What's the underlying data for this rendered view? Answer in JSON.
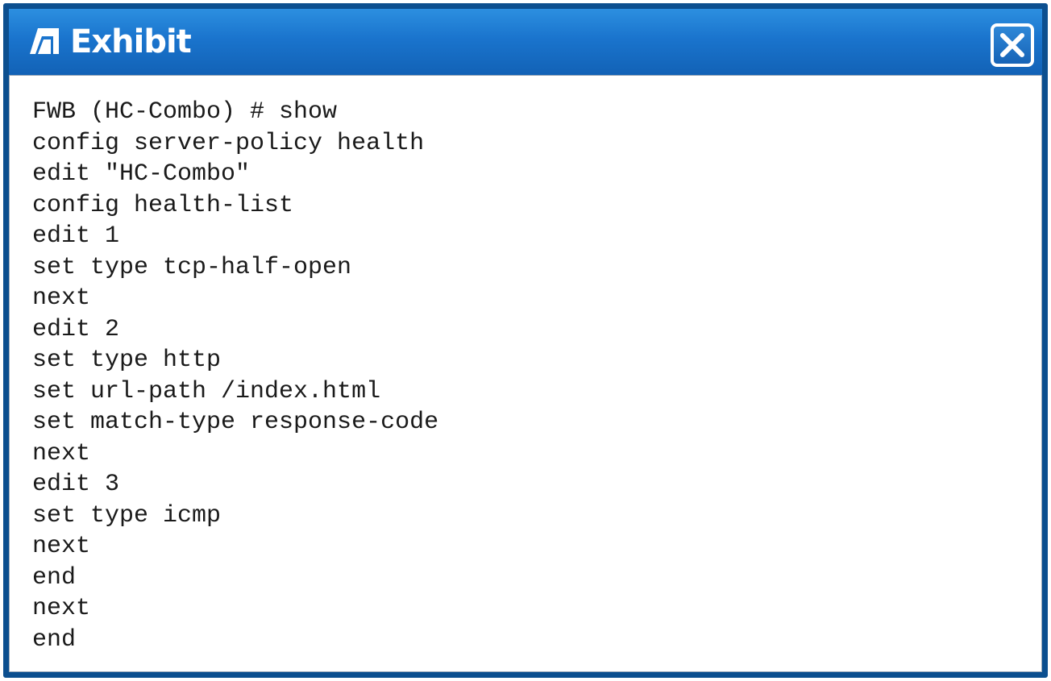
{
  "window": {
    "title": "Exhibit",
    "title_icon": "exhibit-app-icon",
    "close_icon": "close-icon"
  },
  "cli": {
    "lines": [
      "FWB (HC-Combo) # show",
      "config server-policy health",
      "edit \"HC-Combo\"",
      "config health-list",
      "edit 1",
      "set type tcp-half-open",
      "next",
      "edit 2",
      "set type http",
      "set url-path /index.html",
      "set match-type response-code",
      "next",
      "edit 3",
      "set type icmp",
      "next",
      "end",
      "next",
      "end"
    ]
  },
  "colors": {
    "titlebar": "#1a74cd",
    "frame": "#0c4f8f",
    "content_bg": "#ffffff",
    "text": "#1a1a1a"
  }
}
